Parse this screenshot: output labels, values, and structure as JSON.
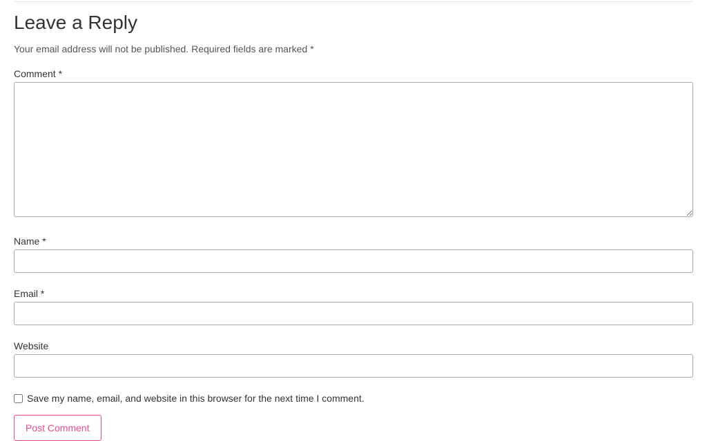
{
  "reply": {
    "title": "Leave a Reply",
    "notes_prefix": "Your email address will not be published.",
    "notes_required": "Required fields are marked",
    "required_mark": "*"
  },
  "fields": {
    "comment": {
      "label": "Comment ",
      "value": ""
    },
    "name": {
      "label": "Name ",
      "value": ""
    },
    "email": {
      "label": "Email ",
      "value": ""
    },
    "website": {
      "label": "Website",
      "value": ""
    }
  },
  "consent": {
    "label": "Save my name, email, and website in this browser for the next time I comment.",
    "checked": false
  },
  "submit": {
    "label": "Post Comment"
  }
}
